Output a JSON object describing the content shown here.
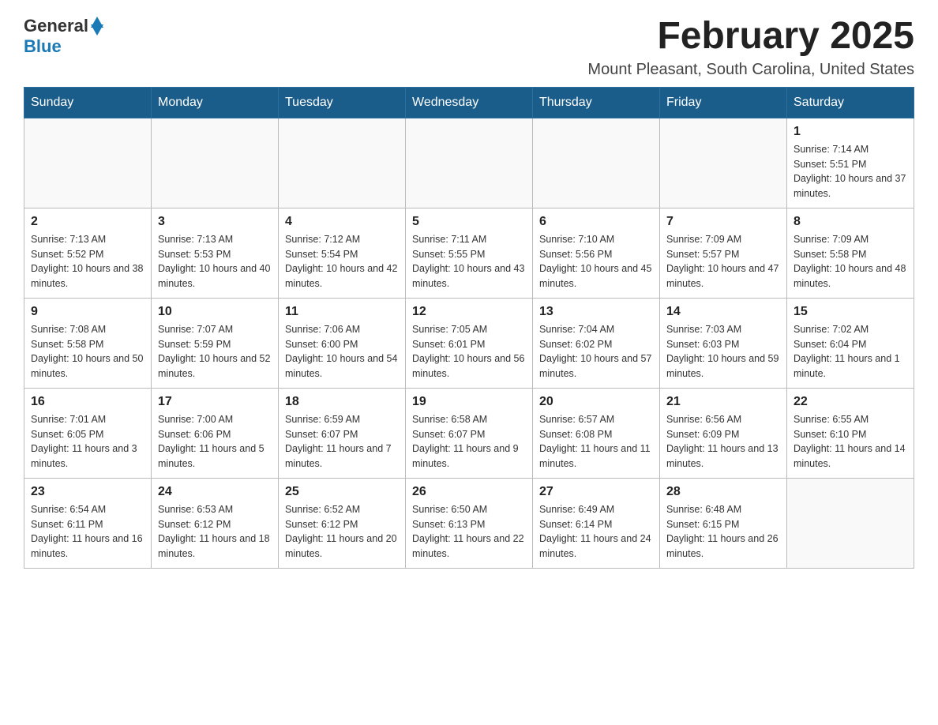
{
  "header": {
    "logo": {
      "text_general": "General",
      "text_blue": "Blue",
      "tagline": "GeneralBlue"
    },
    "title": "February 2025",
    "subtitle": "Mount Pleasant, South Carolina, United States"
  },
  "weekdays": [
    "Sunday",
    "Monday",
    "Tuesday",
    "Wednesday",
    "Thursday",
    "Friday",
    "Saturday"
  ],
  "weeks": [
    [
      {
        "day": "",
        "info": ""
      },
      {
        "day": "",
        "info": ""
      },
      {
        "day": "",
        "info": ""
      },
      {
        "day": "",
        "info": ""
      },
      {
        "day": "",
        "info": ""
      },
      {
        "day": "",
        "info": ""
      },
      {
        "day": "1",
        "info": "Sunrise: 7:14 AM\nSunset: 5:51 PM\nDaylight: 10 hours and 37 minutes."
      }
    ],
    [
      {
        "day": "2",
        "info": "Sunrise: 7:13 AM\nSunset: 5:52 PM\nDaylight: 10 hours and 38 minutes."
      },
      {
        "day": "3",
        "info": "Sunrise: 7:13 AM\nSunset: 5:53 PM\nDaylight: 10 hours and 40 minutes."
      },
      {
        "day": "4",
        "info": "Sunrise: 7:12 AM\nSunset: 5:54 PM\nDaylight: 10 hours and 42 minutes."
      },
      {
        "day": "5",
        "info": "Sunrise: 7:11 AM\nSunset: 5:55 PM\nDaylight: 10 hours and 43 minutes."
      },
      {
        "day": "6",
        "info": "Sunrise: 7:10 AM\nSunset: 5:56 PM\nDaylight: 10 hours and 45 minutes."
      },
      {
        "day": "7",
        "info": "Sunrise: 7:09 AM\nSunset: 5:57 PM\nDaylight: 10 hours and 47 minutes."
      },
      {
        "day": "8",
        "info": "Sunrise: 7:09 AM\nSunset: 5:58 PM\nDaylight: 10 hours and 48 minutes."
      }
    ],
    [
      {
        "day": "9",
        "info": "Sunrise: 7:08 AM\nSunset: 5:58 PM\nDaylight: 10 hours and 50 minutes."
      },
      {
        "day": "10",
        "info": "Sunrise: 7:07 AM\nSunset: 5:59 PM\nDaylight: 10 hours and 52 minutes."
      },
      {
        "day": "11",
        "info": "Sunrise: 7:06 AM\nSunset: 6:00 PM\nDaylight: 10 hours and 54 minutes."
      },
      {
        "day": "12",
        "info": "Sunrise: 7:05 AM\nSunset: 6:01 PM\nDaylight: 10 hours and 56 minutes."
      },
      {
        "day": "13",
        "info": "Sunrise: 7:04 AM\nSunset: 6:02 PM\nDaylight: 10 hours and 57 minutes."
      },
      {
        "day": "14",
        "info": "Sunrise: 7:03 AM\nSunset: 6:03 PM\nDaylight: 10 hours and 59 minutes."
      },
      {
        "day": "15",
        "info": "Sunrise: 7:02 AM\nSunset: 6:04 PM\nDaylight: 11 hours and 1 minute."
      }
    ],
    [
      {
        "day": "16",
        "info": "Sunrise: 7:01 AM\nSunset: 6:05 PM\nDaylight: 11 hours and 3 minutes."
      },
      {
        "day": "17",
        "info": "Sunrise: 7:00 AM\nSunset: 6:06 PM\nDaylight: 11 hours and 5 minutes."
      },
      {
        "day": "18",
        "info": "Sunrise: 6:59 AM\nSunset: 6:07 PM\nDaylight: 11 hours and 7 minutes."
      },
      {
        "day": "19",
        "info": "Sunrise: 6:58 AM\nSunset: 6:07 PM\nDaylight: 11 hours and 9 minutes."
      },
      {
        "day": "20",
        "info": "Sunrise: 6:57 AM\nSunset: 6:08 PM\nDaylight: 11 hours and 11 minutes."
      },
      {
        "day": "21",
        "info": "Sunrise: 6:56 AM\nSunset: 6:09 PM\nDaylight: 11 hours and 13 minutes."
      },
      {
        "day": "22",
        "info": "Sunrise: 6:55 AM\nSunset: 6:10 PM\nDaylight: 11 hours and 14 minutes."
      }
    ],
    [
      {
        "day": "23",
        "info": "Sunrise: 6:54 AM\nSunset: 6:11 PM\nDaylight: 11 hours and 16 minutes."
      },
      {
        "day": "24",
        "info": "Sunrise: 6:53 AM\nSunset: 6:12 PM\nDaylight: 11 hours and 18 minutes."
      },
      {
        "day": "25",
        "info": "Sunrise: 6:52 AM\nSunset: 6:12 PM\nDaylight: 11 hours and 20 minutes."
      },
      {
        "day": "26",
        "info": "Sunrise: 6:50 AM\nSunset: 6:13 PM\nDaylight: 11 hours and 22 minutes."
      },
      {
        "day": "27",
        "info": "Sunrise: 6:49 AM\nSunset: 6:14 PM\nDaylight: 11 hours and 24 minutes."
      },
      {
        "day": "28",
        "info": "Sunrise: 6:48 AM\nSunset: 6:15 PM\nDaylight: 11 hours and 26 minutes."
      },
      {
        "day": "",
        "info": ""
      }
    ]
  ]
}
